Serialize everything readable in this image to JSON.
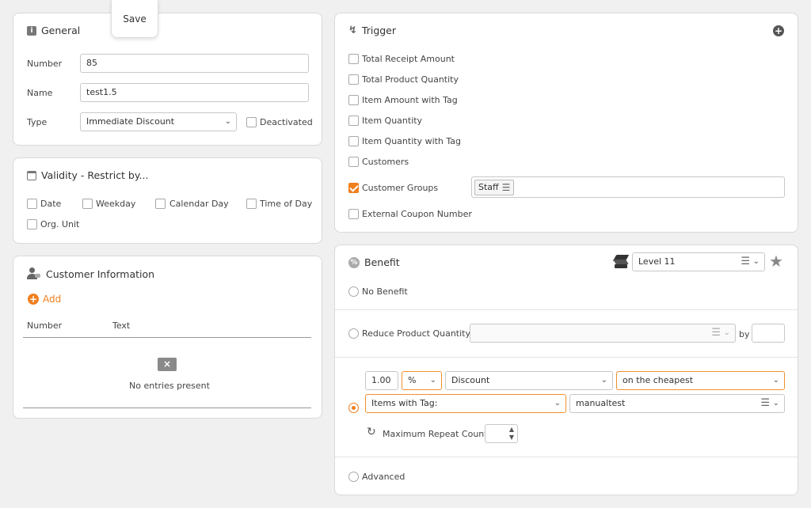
{
  "save_button": "Save",
  "general": {
    "title": "General",
    "number_label": "Number",
    "number_value": "85",
    "name_label": "Name",
    "name_value": "test1.5",
    "type_label": "Type",
    "type_value": "Immediate Discount",
    "deactivated_label": "Deactivated"
  },
  "validity": {
    "title": "Validity - Restrict by...",
    "options": [
      "Date",
      "Weekday",
      "Calendar Day",
      "Time of Day",
      "Org. Unit"
    ]
  },
  "customer_info": {
    "title": "Customer Information",
    "add_label": "Add",
    "col_number": "Number",
    "col_text": "Text",
    "empty_text": "No entries present"
  },
  "trigger": {
    "title": "Trigger",
    "options": [
      "Total Receipt Amount",
      "Total Product Quantity",
      "Item Amount with Tag",
      "Item Quantity",
      "Item Quantity with Tag",
      "Customers",
      "Customer Groups",
      "External Coupon Number"
    ],
    "customer_group_chip": "Staff"
  },
  "benefit": {
    "title": "Benefit",
    "level_value": "Level 11",
    "no_benefit": "No Benefit",
    "reduce_qty": "Reduce Product Quantity",
    "by_label": "by",
    "amount_value": "1.00",
    "unit_value": "%",
    "discount_value": "Discount",
    "cheapest_value": "on the cheapest",
    "items_with_tag_value": "Items with Tag:",
    "tag_value": "manualtest",
    "max_repeat_label": "Maximum Repeat Count",
    "advanced": "Advanced"
  },
  "colors": {
    "accent": "#f07f1e",
    "border": "#d9d9d9",
    "background": "#f0f0f0"
  }
}
